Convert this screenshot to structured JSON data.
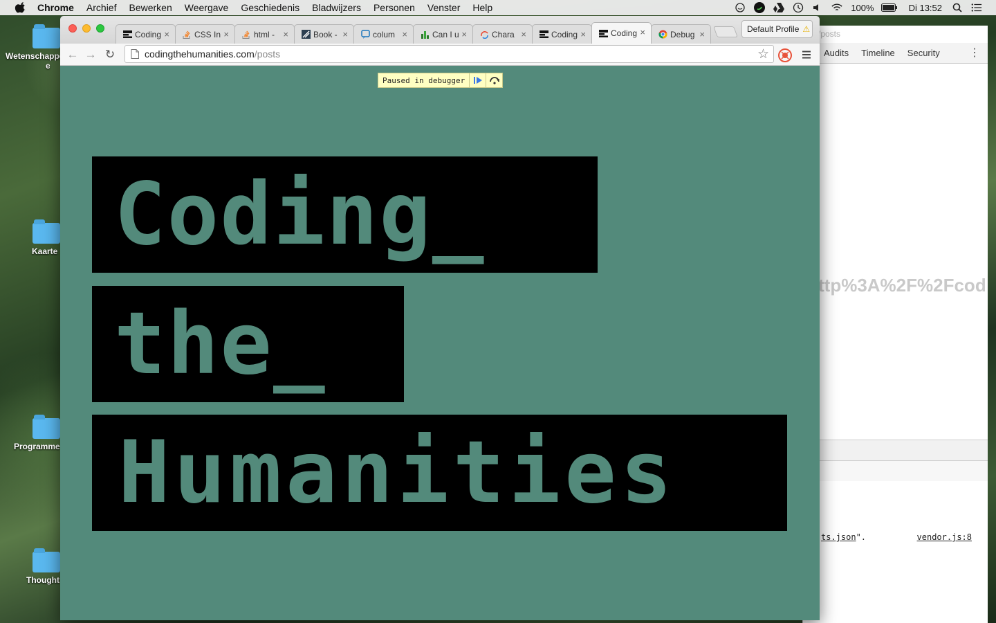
{
  "menubar": {
    "app_name": "Chrome",
    "items": [
      "Archief",
      "Bewerken",
      "Weergave",
      "Geschiedenis",
      "Bladwijzers",
      "Personen",
      "Venster",
      "Help"
    ],
    "battery": "100%",
    "clock": "Di 13:52"
  },
  "desktop": {
    "icons": [
      "Wetenschappe",
      "Kaarte",
      "Programme",
      "Thought"
    ],
    "icon_extra": "e"
  },
  "devtools": {
    "url_ghost": "/posts",
    "tabs": [
      "Audits",
      "Timeline",
      "Security"
    ],
    "ghost_text": "ttp%3A%2F%2Fcod",
    "console_file": "ts.json",
    "console_tail": "\".",
    "console_source": "vendor.js:8"
  },
  "browser": {
    "tabs": [
      {
        "title": "Coding",
        "icon": "coding-favicon"
      },
      {
        "title": "CSS In",
        "icon": "stackoverflow-favicon"
      },
      {
        "title": "html -",
        "icon": "stackoverflow-favicon"
      },
      {
        "title": "Book -",
        "icon": "book-favicon"
      },
      {
        "title": "colum",
        "icon": "column-favicon"
      },
      {
        "title": "Can I u",
        "icon": "caniuse-favicon"
      },
      {
        "title": "Chara",
        "icon": "character-favicon"
      },
      {
        "title": "Coding",
        "icon": "coding-favicon"
      },
      {
        "title": "Coding",
        "icon": "coding-favicon"
      },
      {
        "title": "Debug",
        "icon": "chrome-favicon"
      }
    ],
    "active_tab_index": 8,
    "profile_label": "Default Profile",
    "url_host": "codingthehumanities.com",
    "url_path": "/posts"
  },
  "page": {
    "debugger_text": "Paused in debugger",
    "title_lines": [
      "Coding_",
      "the_",
      "Humanities"
    ],
    "colors": {
      "background": "#538a7b",
      "block": "#000000"
    }
  }
}
